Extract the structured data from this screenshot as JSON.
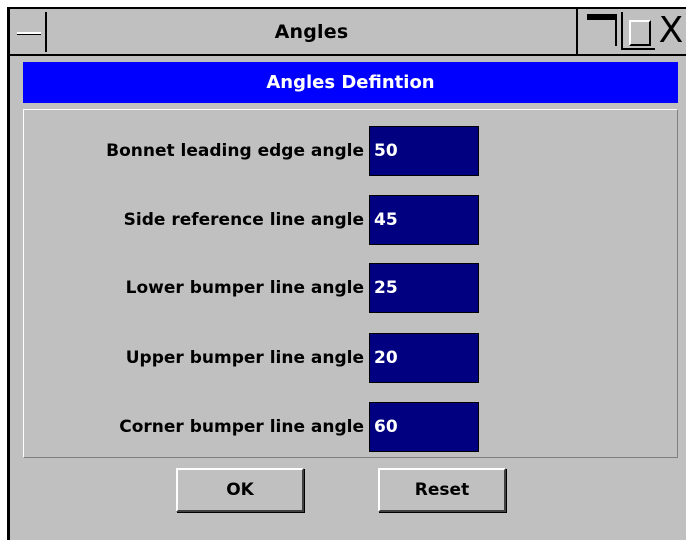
{
  "window": {
    "title": "Angles",
    "controls": {
      "system_menu_icon": "minus-bar-icon",
      "maximize_icon": "maximize-icon",
      "minimize_icon": "minimize-icon",
      "close_icon": "close-icon",
      "close_glyph": "X"
    }
  },
  "header": {
    "title": "Angles Defintion",
    "background": "#0000ff"
  },
  "fields": [
    {
      "label": "Bonnet leading edge angle",
      "value": "50"
    },
    {
      "label": "Side reference line angle",
      "value": "45"
    },
    {
      "label": "Lower bumper line angle",
      "value": "25"
    },
    {
      "label": "Upper bumper line angle",
      "value": "20"
    },
    {
      "label": "Corner bumper line angle",
      "value": "60"
    }
  ],
  "buttons": {
    "ok": "OK",
    "reset": "Reset"
  },
  "colors": {
    "input_background": "#000080",
    "input_text": "#ffffff",
    "window_background": "#c0c0c0"
  }
}
